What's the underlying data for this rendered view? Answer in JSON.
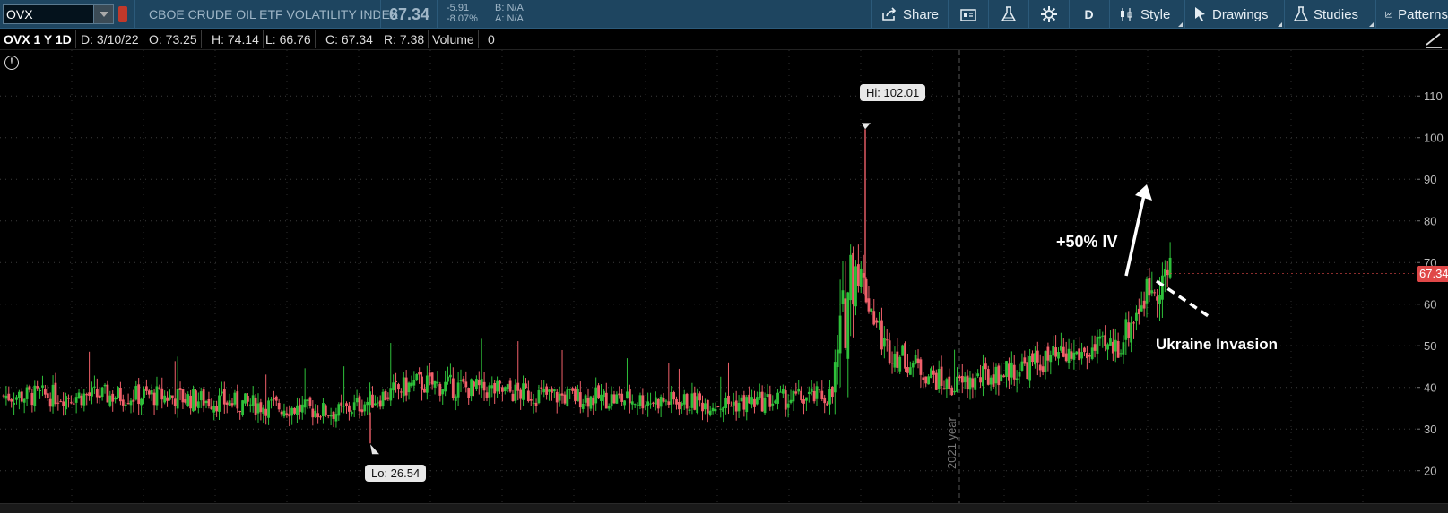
{
  "toolbar": {
    "symbol_value": "OVX",
    "index_name": "CBOE CRUDE OIL ETF VOLATILITY INDEX",
    "last_price": "67.34",
    "net_change": "-5.91",
    "pct_change": "-8.07%",
    "bid": "B: N/A",
    "ask": "A: N/A",
    "share_label": "Share",
    "aggregation_label": "D",
    "style_label": "Style",
    "drawings_label": "Drawings",
    "studies_label": "Studies",
    "patterns_label": "Patterns"
  },
  "infobar": {
    "symbol": "OVX 1 Y 1D",
    "date": "D: 3/10/22",
    "open": "O: 73.25",
    "high": "H: 74.14",
    "low": "L: 66.76",
    "close": "C: 67.34",
    "range": "R: 7.38",
    "volume_label": "Volume",
    "volume_value": "0"
  },
  "chart_labels": {
    "high_callout": "Hi: 102.01",
    "low_callout": "Lo: 26.54",
    "year_marker": "2021 year",
    "last_price_tag": "67.34",
    "annotation_iv": "+50% IV",
    "annotation_event": "Ukraine Invasion"
  },
  "colors": {
    "up": "#2ec13a",
    "down": "#f0606a",
    "toolbar_bg": "#1e4560",
    "price_tag": "#e04848"
  },
  "icons": [
    "share-icon",
    "calendar-icon",
    "flask-icon",
    "gear-icon",
    "style-icon",
    "cursor-icon",
    "studies-flask-icon",
    "patterns-icon",
    "alert-icon",
    "scale-icon"
  ],
  "chart_data": {
    "type": "candlestick",
    "title": "",
    "ylim": [
      18,
      115
    ],
    "y_ticks": [
      20,
      30,
      40,
      50,
      60,
      70,
      80,
      90,
      100,
      110
    ],
    "grid": true,
    "high": 102.01,
    "low": 26.54,
    "last": 67.34,
    "segments": [
      {
        "bars": 60,
        "start": 38,
        "end": 38,
        "peak": 0
      },
      {
        "bars": 70,
        "start": 38,
        "end": 34,
        "peak": 0
      },
      {
        "bars": 30,
        "start": 34,
        "end": 41,
        "peak": 0
      },
      {
        "bars": 50,
        "start": 41,
        "end": 38,
        "peak": 0
      },
      {
        "bars": 70,
        "start": 38,
        "end": 36,
        "peak": 0
      },
      {
        "bars": 40,
        "start": 36,
        "end": 38,
        "peak": 0
      },
      {
        "bars": 8,
        "start": 38,
        "end": 72,
        "peak": 1
      },
      {
        "bars": 12,
        "start": 72,
        "end": 50,
        "peak": 0
      },
      {
        "bars": 25,
        "start": 50,
        "end": 40,
        "peak": 0
      },
      {
        "bars": 35,
        "start": 40,
        "end": 46,
        "peak": 0
      },
      {
        "bars": 30,
        "start": 46,
        "end": 50,
        "peak": 0
      },
      {
        "bars": 12,
        "start": 50,
        "end": 64,
        "peak": 0
      },
      {
        "bars": 8,
        "start": 64,
        "end": 67.34,
        "peak": 0
      }
    ]
  }
}
